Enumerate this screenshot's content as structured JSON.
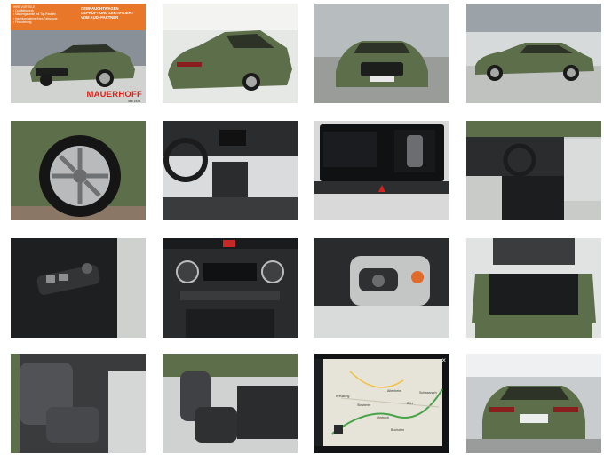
{
  "gallery": {
    "tile_count": 16,
    "hero": {
      "banner_left_lines": [
        "IHRE VORTEILE",
        "• Qualitätscheck",
        "• Markengarantie mit Top-Paketen",
        "• Inzahlungnahme Ihres Fahrzeugs",
        "• Finanzierung"
      ],
      "banner_right_lines": [
        "GEBRAUCHTWAGEN",
        "GEPRÜFT UND ZERTIFIZIERT",
        "VOM AUDI-PARTNER"
      ],
      "dealer_name": "MAUERHOFF",
      "dealer_sub": "seit 1923"
    },
    "nav_screen": {
      "close_symbol": "×",
      "place_names": [
        "Kreuzung",
        "Sinsheim",
        "Altenheim",
        "Bühl",
        "Vimbuch",
        "Buchofen",
        "Schwarzach"
      ]
    },
    "colors": {
      "car_green": "#5d6e4a",
      "banner_orange": "#e8772a",
      "dealer_red": "#d9251c"
    }
  }
}
